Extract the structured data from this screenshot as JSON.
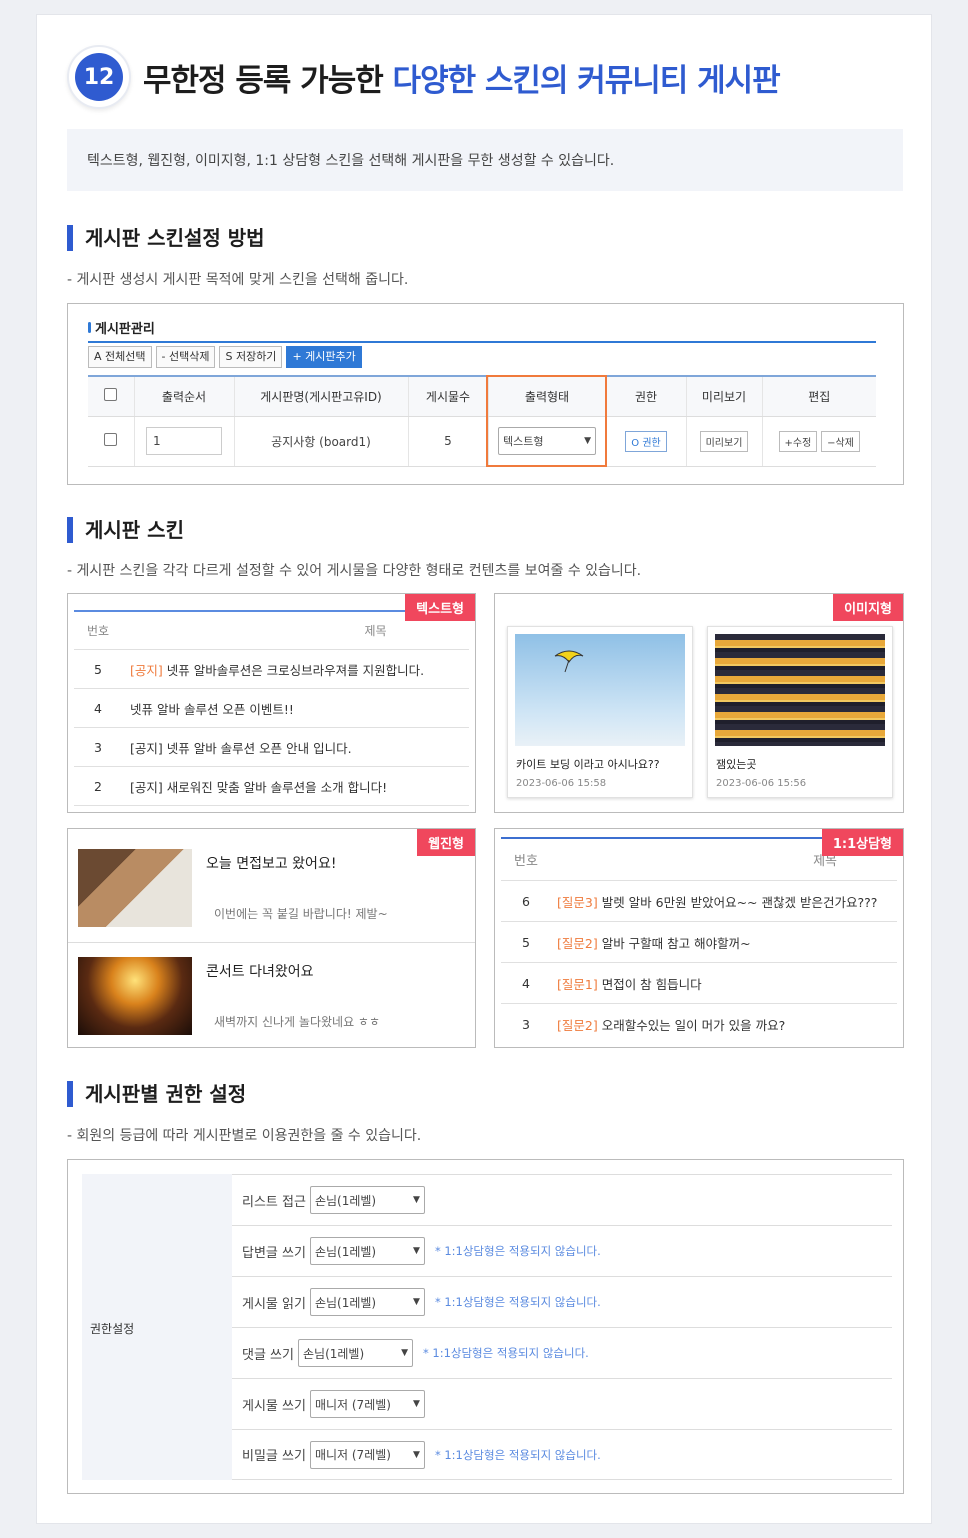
{
  "header": {
    "number": "12",
    "title_plain": "무한정 등록 가능한 ",
    "title_accent": "다양한 스킨의 커뮤니티 게시판"
  },
  "intro": "텍스트형, 웹진형, 이미지형, 1:1 상담형 스킨을 선택해 게시판을 무한 생성할 수 있습니다.",
  "sections": [
    {
      "title": "게시판 스킨설정 방법",
      "desc": "- 게시판 생성시 게시판 목적에 맞게 스킨을 선택해 줍니다."
    },
    {
      "title": "게시판 스킨",
      "desc": "- 게시판 스킨을 각각 다르게 설정할 수 있어 게시물을 다양한 형태로 컨텐츠를 보여줄 수 있습니다."
    },
    {
      "title": "게시판별 권한 설정",
      "desc": "- 회원의 등급에 따라 게시판별로 이용권한을 줄 수 있습니다."
    }
  ],
  "admin": {
    "title": "게시판관리",
    "buttons": [
      "A 전체선택",
      "- 선택삭제",
      "S 저장하기",
      "+ 게시판추가"
    ],
    "columns": [
      "",
      "출력순서",
      "게시판명(게시판고유ID)",
      "게시물수",
      "출력형태",
      "권한",
      "미리보기",
      "편집"
    ],
    "row": {
      "order": "1",
      "name": "공지사항 (board1)",
      "count": "5",
      "type": "텍스트형",
      "perm": "O 권한",
      "preview": "미리보기",
      "edit": "+수정",
      "del": "−삭제"
    }
  },
  "skins": {
    "text": {
      "tag": "텍스트형",
      "col_no": "번호",
      "col_sub": "제목",
      "rows": [
        {
          "no": "5",
          "prefix": "[공지]",
          "title": " 넷퓨 알바솔루션은 크로싱브라우져를 지원합니다."
        },
        {
          "no": "4",
          "prefix": "",
          "title": "넷퓨 알바 솔루션 오픈 이벤트!!"
        },
        {
          "no": "3",
          "prefix": "",
          "title": "[공지] 넷퓨 알바 솔루션 오픈 안내 입니다."
        },
        {
          "no": "2",
          "prefix": "",
          "title": "[공지] 새로워진 맞춤 알바 솔루션을 소개 합니다!"
        }
      ]
    },
    "image": {
      "tag": "이미지형",
      "cards": [
        {
          "title": "카이트 보딩 이라고 아시나요??",
          "date": "2023-06-06 15:58"
        },
        {
          "title": "잼있는곳",
          "date": "2023-06-06 15:56"
        }
      ]
    },
    "webzine": {
      "tag": "웹진형",
      "items": [
        {
          "title": "오늘 면접보고 왔어요!",
          "desc": "이번에는 꼭 붙길 바랍니다! 제발~"
        },
        {
          "title": "콘서트 다녀왔어요",
          "desc": "새벽까지 신나게 놀다왔네요 ㅎㅎ"
        }
      ]
    },
    "qna": {
      "tag": "1:1상담형",
      "col_no": "번호",
      "col_sub": "제목",
      "rows": [
        {
          "no": "6",
          "prefix": "[질문3]",
          "title": " 발렛 알바 6만원 받았어요~~ 괜찮겠 받은건가요???"
        },
        {
          "no": "5",
          "prefix": "[질문2]",
          "title": " 알바 구할때 참고 해야할꺼~"
        },
        {
          "no": "4",
          "prefix": "[질문1]",
          "title": " 면접이 참 힘듭니다"
        },
        {
          "no": "3",
          "prefix": "[질문2]",
          "title": " 오래할수있는 일이 머가 있을 까요?"
        }
      ]
    }
  },
  "perm": {
    "label": "권한설정",
    "rows": [
      {
        "label": "리스트 접근",
        "value": "손님(1레벨)",
        "note": ""
      },
      {
        "label": "답변글 쓰기",
        "value": "손님(1레벨)",
        "note": "* 1:1상담형은 적용되지 않습니다."
      },
      {
        "label": "게시물 읽기",
        "value": "손님(1레벨)",
        "note": "* 1:1상담형은 적용되지 않습니다."
      },
      {
        "label": "댓글 쓰기",
        "value": "손님(1레벨)",
        "note": "* 1:1상담형은 적용되지 않습니다."
      },
      {
        "label": "게시물 쓰기",
        "value": "매니저 (7레벨)",
        "note": ""
      },
      {
        "label": "비밀글 쓰기",
        "value": "매니저 (7레벨)",
        "note": "* 1:1상담형은 적용되지 않습니다."
      }
    ]
  }
}
